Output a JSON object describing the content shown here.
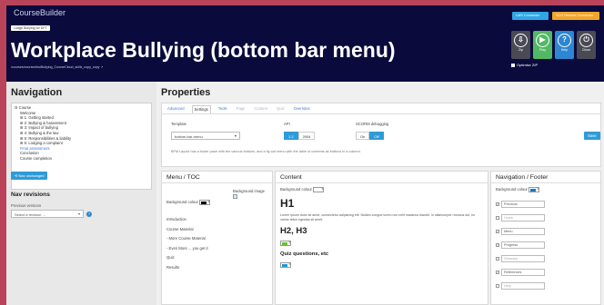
{
  "app": {
    "brand": "CourseBuilder",
    "tag": "Lodge Bullying for DFT",
    "course_title": "Workplace Bullying (bottom bar menu)",
    "path": "/courses/courses/bulBullying_CourseCloud_skillz_copy_copy ↗"
  },
  "header_buttons": {
    "lms": "LMS Connector",
    "remote": "SCO Remote Connector"
  },
  "tools": [
    {
      "label": "Zip",
      "glyph": "⇩"
    },
    {
      "label": "Play",
      "glyph": "▶"
    },
    {
      "label": "Help",
      "glyph": "?"
    },
    {
      "label": "Close",
      "glyph": "⏻"
    }
  ],
  "optimise_zip": "Optimise ZIP",
  "navigation": {
    "title": "Navigation",
    "tree": [
      {
        "label": "⊟ Course",
        "level": 0
      },
      {
        "label": "Welcome",
        "level": 1
      },
      {
        "label": "⊞ 1: Getting started",
        "level": 1
      },
      {
        "label": "⊞ 2: Bullying & harassment",
        "level": 1
      },
      {
        "label": "⊞ 3: Impact of bullying",
        "level": 1
      },
      {
        "label": "⊞ 4: Bullying & the law",
        "level": 1
      },
      {
        "label": "⊞ 5: Responsibilities & liability",
        "level": 1
      },
      {
        "label": "⊞ 6: Lodging a complaint",
        "level": 1
      },
      {
        "label": "Final assessment",
        "level": 1,
        "selected": true
      },
      {
        "label": "Conclusion",
        "level": 1
      },
      {
        "label": "Course completion",
        "level": 1
      }
    ],
    "rev_button": "⟲ Nav unchanged",
    "revisions_title": "Nav revisions",
    "previous_versions": "Previous versions",
    "select_placeholder": "Select a revision ..."
  },
  "properties": {
    "title": "Properties",
    "tabs": [
      {
        "label": "Advanced"
      },
      {
        "label": "Settings",
        "active": true
      },
      {
        "label": "Tools"
      },
      {
        "label": "Page",
        "muted": true
      },
      {
        "label": "Content",
        "muted": true
      },
      {
        "label": "Quiz",
        "muted": true
      },
      {
        "label": "Overrides"
      }
    ],
    "template_label": "Template",
    "template_value": "bottom-bar-menu",
    "api_label": "API",
    "api_options": [
      {
        "label": "1.2",
        "on": true
      },
      {
        "label": "2004"
      }
    ],
    "scorm_label": "SCORM debugging",
    "scorm_options": [
      {
        "label": "On"
      },
      {
        "label": "Off",
        "on": true
      }
    ],
    "save": "Save",
    "description": "BFM Layout has a footer pane with the various buttons, and a fly-out menu with the table of contents as buttons in a column."
  },
  "menu_toc": {
    "title": "Menu / TOC",
    "bg_label": "Background colour",
    "bg_color": "#000000",
    "bg_image_label": "Background image",
    "items": [
      "Introduction",
      "Course Material",
      " - More Course Material",
      " - Even More ... you get it",
      "Quiz",
      "Results"
    ]
  },
  "content": {
    "title": "Content",
    "bg_label": "Background colour",
    "bg_color": "#ffffff",
    "h1": "H1",
    "lorem": "Lorem ipsum dolor sit amet, consectetur adipiscing elit. Nullam congue lorem non velit maximus blandit. In ullamcorper rhoncus dui, eu varius tellus egestas sit amet.",
    "h2": "H2, H3",
    "h2_color": "#6cbf2a",
    "quiz": "Quiz questions, etc",
    "quiz_color": "#1a9ad9"
  },
  "nav_footer": {
    "title": "Navigation / Footer",
    "bg_label": "Background colour",
    "bg_color": "#1a7ac8",
    "items": [
      {
        "label": "Previous",
        "checked": true
      },
      {
        "label": "Home",
        "checked": false
      },
      {
        "label": "Menu",
        "checked": true
      },
      {
        "label": "Progress",
        "checked": true
      },
      {
        "label": "Glossary",
        "checked": false
      },
      {
        "label": "References",
        "checked": true
      },
      {
        "label": "Help",
        "checked": false
      }
    ]
  }
}
